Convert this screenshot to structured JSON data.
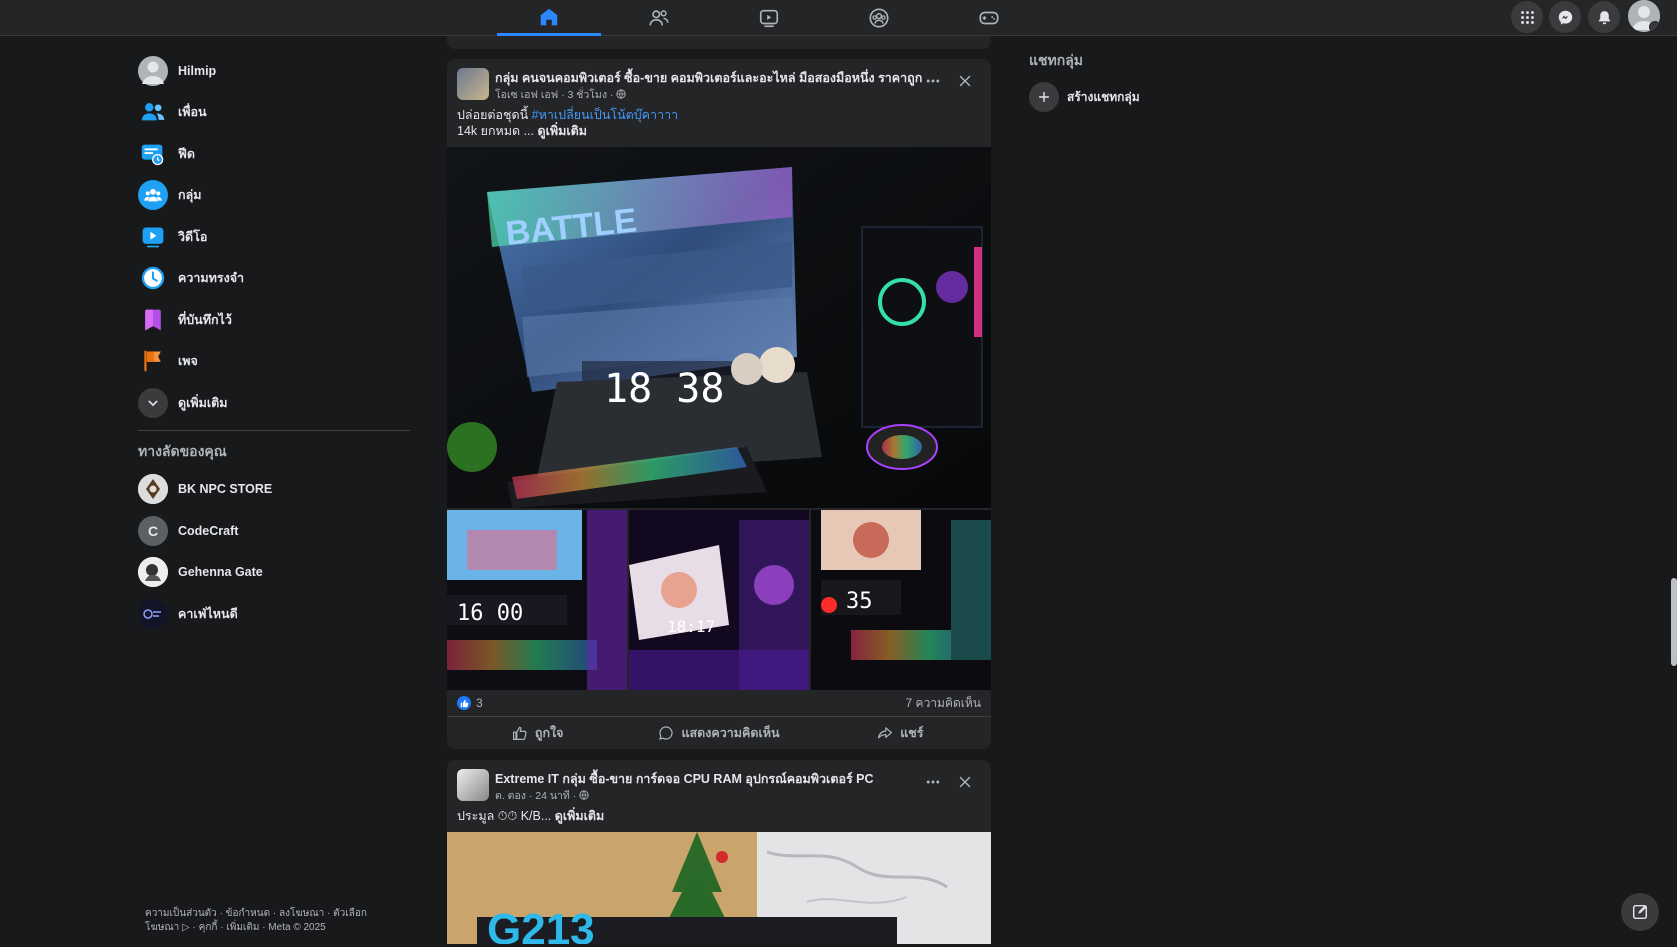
{
  "topnav": {
    "tabs": [
      {
        "name": "home",
        "icon": "home-icon",
        "active": true
      },
      {
        "name": "friends",
        "icon": "friends-icon"
      },
      {
        "name": "watch",
        "icon": "video-icon"
      },
      {
        "name": "groups",
        "icon": "groups-icon"
      },
      {
        "name": "gaming",
        "icon": "gamepad-icon"
      }
    ],
    "right_icons": [
      "menu-grid-icon",
      "messenger-icon",
      "bell-icon",
      "profile-avatar"
    ]
  },
  "sidebar": {
    "items": [
      {
        "label": "Hilmip",
        "icon": "profile-avatar"
      },
      {
        "label": "เพื่อน",
        "icon": "friends-icon"
      },
      {
        "label": "ฟีด",
        "icon": "feed-icon"
      },
      {
        "label": "กลุ่ม",
        "icon": "groups-icon"
      },
      {
        "label": "วิดีโอ",
        "icon": "video-icon"
      },
      {
        "label": "ความทรงจำ",
        "icon": "memories-icon"
      },
      {
        "label": "ที่บันทึกไว้",
        "icon": "bookmark-icon"
      },
      {
        "label": "เพจ",
        "icon": "flag-icon"
      },
      {
        "label": "ดูเพิ่มเติม",
        "icon": "chevron-down-icon"
      }
    ],
    "shortcuts_title": "ทางลัดของคุณ",
    "shortcuts": [
      {
        "label": "BK NPC STORE"
      },
      {
        "label": "CodeCraft",
        "letter": "C"
      },
      {
        "label": "Gehenna Gate"
      },
      {
        "label": "คาเฟ่ไหนดี"
      }
    ],
    "footer_line1": "ความเป็นส่วนตัว · ข้อกำหนด · ลงโฆษณา · ตัวเลือก",
    "footer_line2": "โฆษณา ▷ · คุกกี้ · เพิ่มเติม · Meta © 2025"
  },
  "posts": [
    {
      "group": "กลุ่ม คนจนคอมพิวเตอร์ ซื้อ-ขาย คอมพิวเตอร์และอะไหล่ มือสองมือหนึ่ง ราคาถูก",
      "meta": "โอเซ เอฟ เอฟ · 3 ชั่วโมง · ",
      "text_prefix": "ปล่อยต่อชุดนี้ ",
      "hashtag": "#หาเปลี่ยนเป็นโน้ตบุ๊คาาาา",
      "text_line2": "14k ยกหมด ... ",
      "see_more": "ดูเพิ่มเติม",
      "clock_main": "18 38",
      "clock_thumbs": [
        "16 00",
        "18:17",
        "35"
      ],
      "likes": "3",
      "comments": "7 ความคิดเห็น",
      "actions": {
        "like": "ถูกใจ",
        "comment": "แสดงความคิดเห็น",
        "share": "แชร์"
      }
    },
    {
      "group": "Extreme IT กลุ่ม ซื้อ-ขาย การ์ดจอ CPU RAM อุปกรณ์คอมพิวเตอร์ PC",
      "meta": "ต. ตอง · 24 นาที · ",
      "text": "ประมูล ⏱⏱ K/B... ",
      "see_more": "ดูเพิ่มเติม"
    }
  ],
  "right_panel": {
    "title": "แชทกลุ่ม",
    "create_label": "สร้างแชทกลุ่ม"
  },
  "colors": {
    "accent": "#2d88ff",
    "bg": "#18191a",
    "card": "#242526"
  }
}
